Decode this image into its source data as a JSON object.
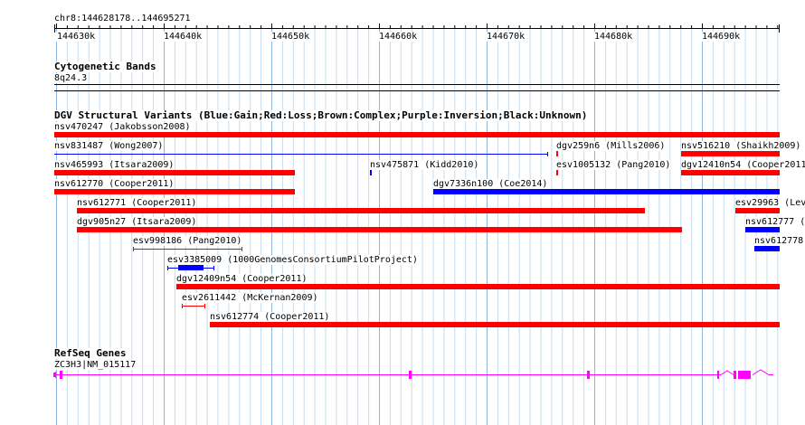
{
  "ruler": {
    "coordinate": "chr8:144628178..144695271",
    "ticks": [
      "144630k",
      "144640k",
      "144650k",
      "144660k",
      "144670k",
      "144680k",
      "144690k"
    ]
  },
  "cytoband": {
    "title": "Cytogenetic Bands",
    "band": "8q24.3"
  },
  "dgv": {
    "title": "DGV Structural Variants (Blue:Gain;Red:Loss;Brown:Complex;Purple:Inversion;Black:Unknown)",
    "colors": {
      "gain": "#0000ff",
      "loss": "#ff0000"
    },
    "variants": [
      {
        "label": "nsv470247 (Jakobsson2008)"
      },
      {
        "label": "nsv831487 (Wong2007)"
      },
      {
        "label": "dgv259n6 (Mills2006)"
      },
      {
        "label": "nsv516210 (Shaikh2009)"
      },
      {
        "label": "nsv465993 (Itsara2009)"
      },
      {
        "label": "nsv475871 (Kidd2010)"
      },
      {
        "label": "esv1005132 (Pang2010)"
      },
      {
        "label": "dgv12410n54 (Cooper2011)"
      },
      {
        "label": "nsv612770 (Cooper2011)"
      },
      {
        "label": "dgv7336n100 (Coe2014)"
      },
      {
        "label": "nsv612771 (Cooper2011)"
      },
      {
        "label": "esv29963 (Lev"
      },
      {
        "label": "dgv905n27 (Itsara2009)"
      },
      {
        "label": "nsv612777 ("
      },
      {
        "label": "esv998186 (Pang2010)"
      },
      {
        "label": "nsv612778"
      },
      {
        "label": "esv3385009 (1000GenomesConsortiumPilotProject)"
      },
      {
        "label": "dgv12409n54 (Cooper2011)"
      },
      {
        "label": "esv2611442 (McKernan2009)"
      },
      {
        "label": "nsv612774 (Cooper2011)"
      }
    ]
  },
  "refseq": {
    "title": "RefSeq Genes",
    "gene": "ZC3H3|NM_015117",
    "color": "#ff00ff"
  }
}
